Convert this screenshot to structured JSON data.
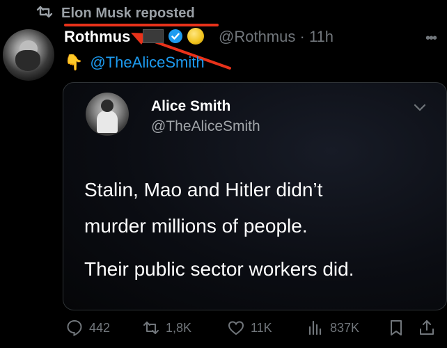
{
  "repost": {
    "label": "Elon Musk reposted",
    "icon": "repost-icon"
  },
  "author": {
    "name": "Rothmus",
    "handle": "@Rothmus",
    "separator": "·",
    "time": "11h",
    "badges": [
      "flag-badge-icon",
      "verified-badge-icon",
      "coin-badge-icon"
    ],
    "more_label": "•••"
  },
  "post": {
    "hand_emoji": "👇",
    "mention": "@TheAliceSmith"
  },
  "quote": {
    "name": "Alice Smith",
    "handle": "@TheAliceSmith",
    "line1": "Stalin, Mao and Hitler didn’t",
    "line2": "murder millions of people.",
    "line3": "Their public sector workers did."
  },
  "actions": {
    "replies": "442",
    "reposts": "1,8K",
    "likes": "11K",
    "views": "837K"
  },
  "colors": {
    "background": "#000000",
    "link": "#1d9bf0",
    "muted": "#71767b",
    "annotation": "#e8321a"
  }
}
